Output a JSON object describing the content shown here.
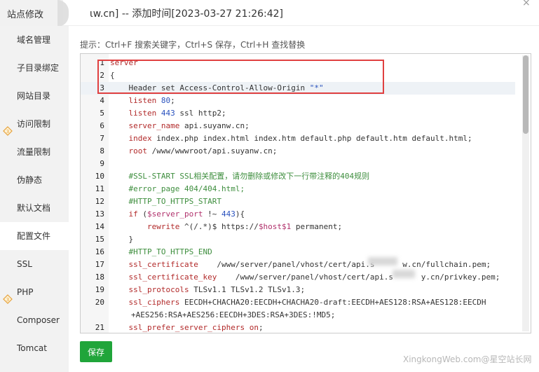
{
  "header": {
    "panel_title": "站点修改",
    "dialog_title": "ιw.cn] -- 添加时间[2023-03-27 21:26:42]",
    "close_symbol": "×"
  },
  "sidebar": {
    "items": [
      {
        "label": "域名管理",
        "vip": false
      },
      {
        "label": "子目录绑定",
        "vip": false
      },
      {
        "label": "网站目录",
        "vip": false
      },
      {
        "label": "访问限制",
        "vip": true
      },
      {
        "label": "流量限制",
        "vip": false
      },
      {
        "label": "伪静态",
        "vip": false
      },
      {
        "label": "默认文档",
        "vip": false
      },
      {
        "label": "配置文件",
        "vip": false,
        "active": true
      },
      {
        "label": "SSL",
        "vip": false
      },
      {
        "label": "PHP",
        "vip": true
      },
      {
        "label": "Composer",
        "vip": false
      },
      {
        "label": "Tomcat",
        "vip": false
      }
    ]
  },
  "hint": "提示：Ctrl+F 搜索关键字，Ctrl+S 保存，Ctrl+H 查找替换",
  "editor": {
    "lines": [
      {
        "n": "1",
        "html": "<span class='kw'>server</span>"
      },
      {
        "n": "2",
        "html": "{"
      },
      {
        "n": "3",
        "html": "    Header set Access-Control-Allow-Origin <span class='str'>\"*\"</span>",
        "current": true
      },
      {
        "n": "4",
        "html": "    <span class='kw'>listen</span> <span class='num'>80</span>;"
      },
      {
        "n": "5",
        "html": "    <span class='kw'>listen</span> <span class='num'>443</span> ssl http2;"
      },
      {
        "n": "6",
        "html": "    <span class='kw'>server_name</span> api.suyanw.cn;"
      },
      {
        "n": "7",
        "html": "    <span class='kw'>index</span> index.php index.html index.htm default.php default.htm default.html;"
      },
      {
        "n": "8",
        "html": "    <span class='kw'>root</span> /www/wwwroot/api.suyanw.cn;"
      },
      {
        "n": "9",
        "html": ""
      },
      {
        "n": "10",
        "html": "    <span class='cm'>#SSL-START SSL相关配置，请勿删除或修改下一行带注释的404规则</span>"
      },
      {
        "n": "11",
        "html": "    <span class='cm'>#error_page 404/404.html;</span>"
      },
      {
        "n": "12",
        "html": "    <span class='cm'>#HTTP_TO_HTTPS_START</span>"
      },
      {
        "n": "13",
        "html": "    <span class='kw'>if</span> (<span class='var'>$server_port</span> !~ <span class='num'>443</span>){"
      },
      {
        "n": "14",
        "html": "        <span class='kw'>rewrite</span> ^(/.*)$ https://<span class='var'>$host$1</span> permanent;"
      },
      {
        "n": "15",
        "html": "    }"
      },
      {
        "n": "16",
        "html": "    <span class='cm'>#HTTP_TO_HTTPS_END</span>"
      },
      {
        "n": "17",
        "html": "    <span class='kw'>ssl_certificate</span>    /www/server/panel/vhost/cert/api.s      w.cn/fullchain.pem;"
      },
      {
        "n": "18",
        "html": "    <span class='kw'>ssl_certificate_key</span>    /www/server/panel/vhost/cert/api.s      y.cn/privkey.pem;"
      },
      {
        "n": "19",
        "html": "    <span class='kw'>ssl_protocols</span> TLSv1.1 TLSv1.2 TLSv1.3;"
      },
      {
        "n": "20",
        "html": "    <span class='kw'>ssl_ciphers</span> EECDH+CHACHA20:EECDH+CHACHA20-draft:EECDH+AES128:RSA+AES128:EECDH<span class='cont'>+AES256:RSA+AES256:EECDH+3DES:RSA+3DES:!MD5;</span>",
        "tall": true
      },
      {
        "n": "21",
        "html": "    <span class='kw'>ssl_prefer_server_ciphers</span> <span class='kw'>on</span>;"
      }
    ]
  },
  "save_button": "保存",
  "watermark": "XingkongWeb.com@星空站长网",
  "vip_badge": "3"
}
